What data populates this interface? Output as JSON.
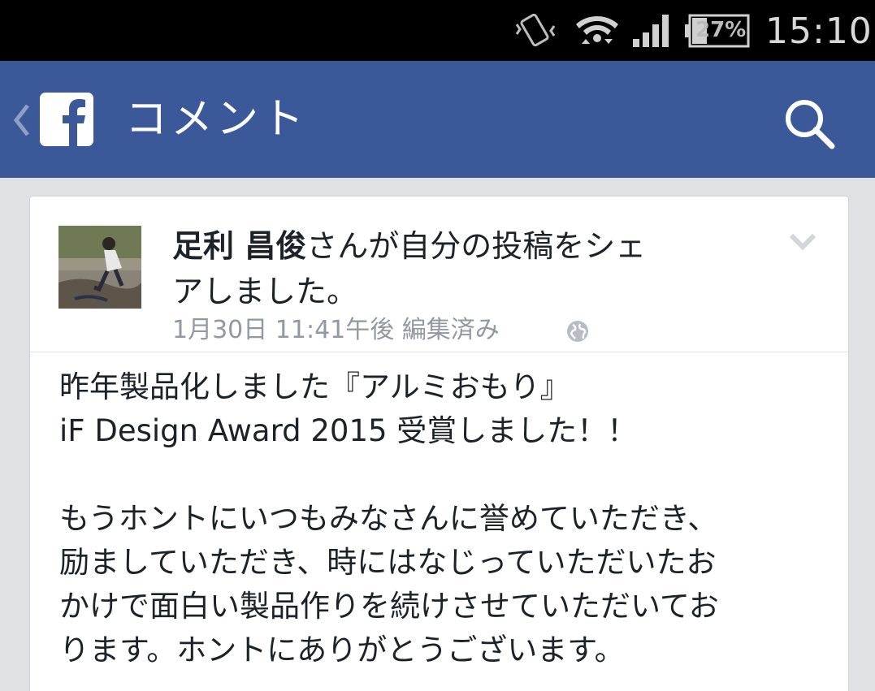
{
  "status_bar": {
    "battery_percent": "27%",
    "time": "15:10",
    "icons": [
      "vibrate-icon",
      "wifi-icon",
      "signal-icon",
      "battery-icon"
    ]
  },
  "app_bar": {
    "title": "コメント",
    "logo_letter": "f",
    "color": "#3b5998",
    "icons": [
      "back-chevron-icon",
      "facebook-logo-icon",
      "search-icon"
    ]
  },
  "post": {
    "author": "足利 昌俊",
    "headline_line1_rest": "さんが自分の投稿をシェ",
    "headline_line2": "アしました。",
    "timestamp": "1月30日 11:41午後 編集済み",
    "body": [
      "昨年製品化しました『アルミおもり』",
      "iF Design Award 2015 受賞しました！！",
      "",
      "もうホントにいつもみなさんに誉めていただき、",
      "励ましていただき、時にはなじっていただいたお",
      "かけで面白い製品作りを続けさせていただいてお",
      "ります。ホントにありがとうございます。"
    ],
    "icons": [
      "avatar",
      "chevron-down-icon",
      "globe-icon"
    ]
  }
}
